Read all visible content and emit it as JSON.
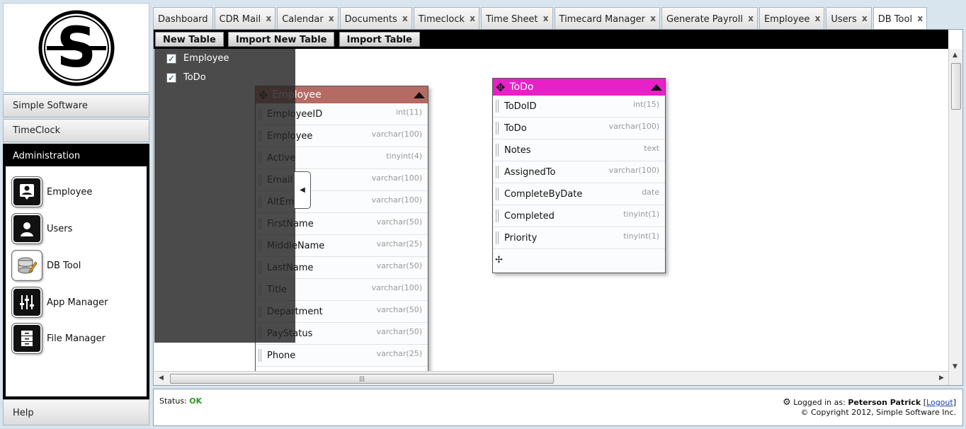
{
  "sidebar": {
    "logo_letter": "S",
    "nav": [
      {
        "label": "Simple Software"
      },
      {
        "label": "TimeClock"
      }
    ],
    "admin_title": "Administration",
    "apps": [
      {
        "label": "Employee",
        "icon": "employee-icon"
      },
      {
        "label": "Users",
        "icon": "users-icon"
      },
      {
        "label": "DB Tool",
        "icon": "db-tool-icon"
      },
      {
        "label": "App Manager",
        "icon": "app-manager-icon"
      },
      {
        "label": "File Manager",
        "icon": "file-manager-icon"
      }
    ],
    "help_label": "Help"
  },
  "tabs": [
    {
      "label": "Dashboard",
      "closable": false
    },
    {
      "label": "CDR Mail",
      "closable": true
    },
    {
      "label": "Calendar",
      "closable": true
    },
    {
      "label": "Documents",
      "closable": true
    },
    {
      "label": "Timeclock",
      "closable": true
    },
    {
      "label": "Time Sheet",
      "closable": true
    },
    {
      "label": "Timecard Manager",
      "closable": true
    },
    {
      "label": "Generate Payroll",
      "closable": true
    },
    {
      "label": "Employee",
      "closable": true
    },
    {
      "label": "Users",
      "closable": true
    },
    {
      "label": "DB Tool",
      "closable": true,
      "active": true
    }
  ],
  "close_glyph": "x",
  "toolbar": {
    "new_table": "New Table",
    "import_new_table": "Import New Table",
    "import_table": "Import Table"
  },
  "table_list": [
    {
      "label": "Employee",
      "checked": true
    },
    {
      "label": "ToDo",
      "checked": true
    }
  ],
  "check_glyph": "✓",
  "tables": {
    "employee": {
      "name": "Employee",
      "color": "#b56a63",
      "fields": [
        {
          "name": "EmployeeID",
          "type": "int(11)"
        },
        {
          "name": "Employee",
          "type": "varchar(100)"
        },
        {
          "name": "Active",
          "type": "tinyint(4)"
        },
        {
          "name": "Email",
          "type": "varchar(100)"
        },
        {
          "name": "AltEm",
          "type": "varchar(100)"
        },
        {
          "name": "FirstName",
          "type": "varchar(50)"
        },
        {
          "name": "MiddleName",
          "type": "varchar(25)"
        },
        {
          "name": "LastName",
          "type": "varchar(50)"
        },
        {
          "name": "Title",
          "type": "varchar(100)"
        },
        {
          "name": "Department",
          "type": "varchar(50)"
        },
        {
          "name": "PayStatus",
          "type": "varchar(50)"
        },
        {
          "name": "Phone",
          "type": "varchar(25)"
        }
      ]
    },
    "todo": {
      "name": "ToDo",
      "color": "#e820c8",
      "fields": [
        {
          "name": "ToDoID",
          "type": "int(15)"
        },
        {
          "name": "ToDo",
          "type": "varchar(100)"
        },
        {
          "name": "Notes",
          "type": "text"
        },
        {
          "name": "AssignedTo",
          "type": "varchar(100)"
        },
        {
          "name": "CompleteByDate",
          "type": "date"
        },
        {
          "name": "Completed",
          "type": "tinyint(1)"
        },
        {
          "name": "Priority",
          "type": "tinyint(1)"
        }
      ]
    }
  },
  "status": {
    "label": "Status:",
    "value": "OK",
    "logged_in_prefix": "Logged in as:",
    "user": "Peterson Patrick",
    "logout": "Logout",
    "copyright": "© Copyright 2012, Simple Software Inc."
  }
}
